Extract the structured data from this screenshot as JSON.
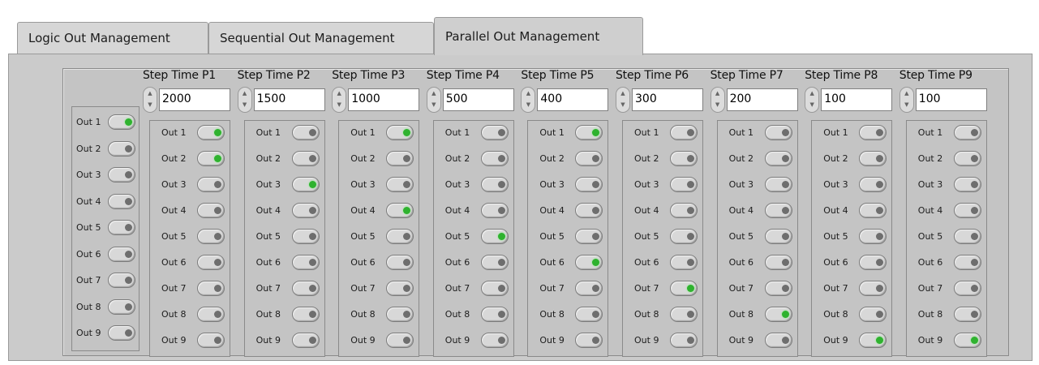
{
  "tabs": [
    {
      "label": "Logic Out Management",
      "active": false
    },
    {
      "label": "Sequential Out Management",
      "active": false
    },
    {
      "label": "Parallel Out Management",
      "active": true
    }
  ],
  "main_outputs": [
    {
      "label": "Out 1",
      "on": true
    },
    {
      "label": "Out 2",
      "on": false
    },
    {
      "label": "Out 3",
      "on": false
    },
    {
      "label": "Out 4",
      "on": false
    },
    {
      "label": "Out 5",
      "on": false
    },
    {
      "label": "Out 6",
      "on": false
    },
    {
      "label": "Out 7",
      "on": false
    },
    {
      "label": "Out 8",
      "on": false
    },
    {
      "label": "Out 9",
      "on": false
    }
  ],
  "steps": [
    {
      "title": "Step Time P1",
      "value": "2000",
      "outputs": [
        true,
        true,
        false,
        false,
        false,
        false,
        false,
        false,
        false
      ]
    },
    {
      "title": "Step Time P2",
      "value": "1500",
      "outputs": [
        false,
        false,
        true,
        false,
        false,
        false,
        false,
        false,
        false
      ]
    },
    {
      "title": "Step Time P3",
      "value": "1000",
      "outputs": [
        true,
        false,
        false,
        true,
        false,
        false,
        false,
        false,
        false
      ]
    },
    {
      "title": "Step Time P4",
      "value": "500",
      "outputs": [
        false,
        false,
        false,
        false,
        true,
        false,
        false,
        false,
        false
      ]
    },
    {
      "title": "Step Time P5",
      "value": "400",
      "outputs": [
        true,
        false,
        false,
        false,
        false,
        true,
        false,
        false,
        false
      ]
    },
    {
      "title": "Step Time P6",
      "value": "300",
      "outputs": [
        false,
        false,
        false,
        false,
        false,
        false,
        true,
        false,
        false
      ]
    },
    {
      "title": "Step Time P7",
      "value": "200",
      "outputs": [
        false,
        false,
        false,
        false,
        false,
        false,
        false,
        true,
        false
      ]
    },
    {
      "title": "Step Time P8",
      "value": "100",
      "outputs": [
        false,
        false,
        false,
        false,
        false,
        false,
        false,
        false,
        true
      ]
    },
    {
      "title": "Step Time P9",
      "value": "100",
      "outputs": [
        false,
        false,
        false,
        false,
        false,
        false,
        false,
        false,
        true
      ]
    }
  ],
  "output_label_prefix": "Out",
  "colors": {
    "led_on": "#2fb22f",
    "led_off": "#6e6e6e",
    "panel_bg": "#cbcbcb"
  }
}
